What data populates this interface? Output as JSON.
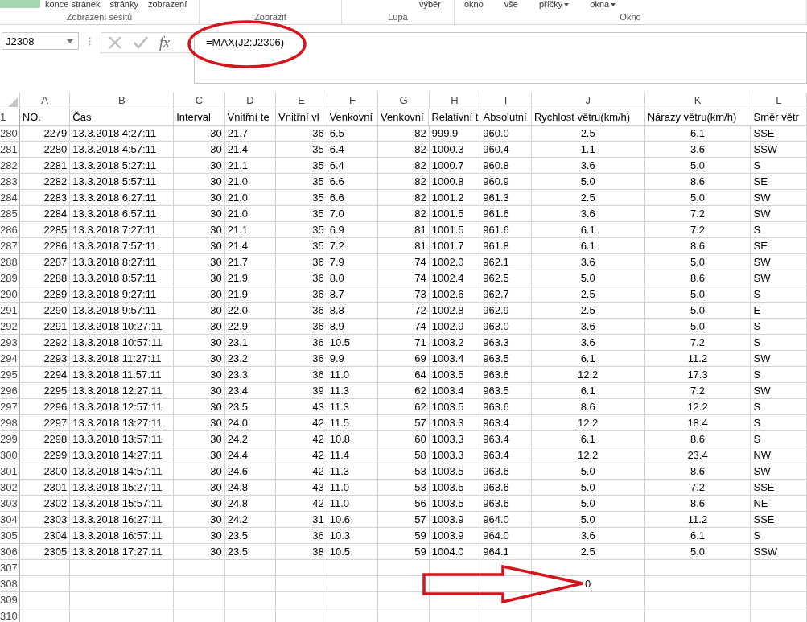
{
  "ribbon": {
    "groups": [
      {
        "label": "Zobrazení sešitů",
        "buttons": [
          {
            "label": "konce stránek",
            "dropdown": false
          },
          {
            "label": "stránky",
            "dropdown": false
          },
          {
            "label": "zobrazení",
            "dropdown": false
          }
        ]
      },
      {
        "label": "Zobrazit"
      },
      {
        "label": "Lupa",
        "buttons": [
          {
            "label": "výběr",
            "dropdown": false
          }
        ]
      },
      {
        "label": "Okno",
        "buttons": [
          {
            "label": "okno",
            "dropdown": false
          },
          {
            "label": "vše",
            "dropdown": false
          },
          {
            "label": "příčky",
            "dropdown": true
          },
          {
            "label": "okna",
            "dropdown": true
          }
        ]
      }
    ]
  },
  "name_box": {
    "value": "J2308"
  },
  "formula_bar": {
    "function_label": "fx",
    "value": "=MAX(J2:J2306)"
  },
  "sheet": {
    "column_letters": [
      "A",
      "B",
      "C",
      "D",
      "E",
      "F",
      "G",
      "H",
      "I",
      "J",
      "K",
      "L"
    ],
    "rows": [
      {
        "number": "1",
        "cells": [
          "NO.",
          "Čas",
          "Interval",
          "Vnitřní te",
          "Vnitřní vl",
          "Venkovní",
          "Venkovní",
          "Relativní t",
          "Absolutní",
          "Rychlost větru(km/h)",
          "Nárazy větru(km/h)",
          "Směr větr"
        ]
      },
      {
        "number": "280",
        "cells": [
          "2279",
          "13.3.2018 4:27:11",
          "30",
          "21.7",
          "36",
          "6.5",
          "82",
          "999.9",
          "960.0",
          "2.5",
          "6.1",
          "SSE"
        ]
      },
      {
        "number": "281",
        "cells": [
          "2280",
          "13.3.2018 4:57:11",
          "30",
          "21.4",
          "35",
          "6.4",
          "82",
          "1000.3",
          "960.4",
          "1.1",
          "3.6",
          "SSW"
        ]
      },
      {
        "number": "282",
        "cells": [
          "2281",
          "13.3.2018 5:27:11",
          "30",
          "21.1",
          "35",
          "6.4",
          "82",
          "1000.7",
          "960.8",
          "3.6",
          "5.0",
          "S"
        ]
      },
      {
        "number": "283",
        "cells": [
          "2282",
          "13.3.2018 5:57:11",
          "30",
          "21.0",
          "35",
          "6.6",
          "82",
          "1000.8",
          "960.9",
          "5.0",
          "8.6",
          "SE"
        ]
      },
      {
        "number": "284",
        "cells": [
          "2283",
          "13.3.2018 6:27:11",
          "30",
          "21.0",
          "35",
          "6.6",
          "82",
          "1001.2",
          "961.3",
          "2.5",
          "5.0",
          "SW"
        ]
      },
      {
        "number": "285",
        "cells": [
          "2284",
          "13.3.2018 6:57:11",
          "30",
          "21.0",
          "35",
          "7.0",
          "82",
          "1001.5",
          "961.6",
          "3.6",
          "7.2",
          "SW"
        ]
      },
      {
        "number": "286",
        "cells": [
          "2285",
          "13.3.2018 7:27:11",
          "30",
          "21.1",
          "35",
          "6.9",
          "81",
          "1001.5",
          "961.6",
          "6.1",
          "7.2",
          "S"
        ]
      },
      {
        "number": "287",
        "cells": [
          "2286",
          "13.3.2018 7:57:11",
          "30",
          "21.4",
          "35",
          "7.2",
          "81",
          "1001.7",
          "961.8",
          "6.1",
          "8.6",
          "SE"
        ]
      },
      {
        "number": "288",
        "cells": [
          "2287",
          "13.3.2018 8:27:11",
          "30",
          "21.7",
          "36",
          "7.9",
          "74",
          "1002.0",
          "962.1",
          "3.6",
          "5.0",
          "SW"
        ]
      },
      {
        "number": "289",
        "cells": [
          "2288",
          "13.3.2018 8:57:11",
          "30",
          "21.9",
          "36",
          "8.0",
          "74",
          "1002.4",
          "962.5",
          "5.0",
          "8.6",
          "SW"
        ]
      },
      {
        "number": "290",
        "cells": [
          "2289",
          "13.3.2018 9:27:11",
          "30",
          "21.9",
          "36",
          "8.7",
          "73",
          "1002.6",
          "962.7",
          "2.5",
          "5.0",
          "S"
        ]
      },
      {
        "number": "291",
        "cells": [
          "2290",
          "13.3.2018 9:57:11",
          "30",
          "22.0",
          "36",
          "8.8",
          "72",
          "1002.8",
          "962.9",
          "2.5",
          "5.0",
          "E"
        ]
      },
      {
        "number": "292",
        "cells": [
          "2291",
          "13.3.2018 10:27:11",
          "30",
          "22.9",
          "36",
          "8.9",
          "74",
          "1002.9",
          "963.0",
          "3.6",
          "5.0",
          "S"
        ]
      },
      {
        "number": "293",
        "cells": [
          "2292",
          "13.3.2018 10:57:11",
          "30",
          "23.1",
          "36",
          "10.5",
          "71",
          "1003.2",
          "963.3",
          "3.6",
          "7.2",
          "S"
        ]
      },
      {
        "number": "294",
        "cells": [
          "2293",
          "13.3.2018 11:27:11",
          "30",
          "23.2",
          "36",
          "9.9",
          "69",
          "1003.4",
          "963.5",
          "6.1",
          "11.2",
          "SW"
        ]
      },
      {
        "number": "295",
        "cells": [
          "2294",
          "13.3.2018 11:57:11",
          "30",
          "23.3",
          "36",
          "11.0",
          "64",
          "1003.5",
          "963.6",
          "12.2",
          "17.3",
          "S"
        ]
      },
      {
        "number": "296",
        "cells": [
          "2295",
          "13.3.2018 12:27:11",
          "30",
          "23.4",
          "39",
          "11.3",
          "62",
          "1003.4",
          "963.5",
          "6.1",
          "7.2",
          "SW"
        ]
      },
      {
        "number": "297",
        "cells": [
          "2296",
          "13.3.2018 12:57:11",
          "30",
          "23.5",
          "43",
          "11.3",
          "62",
          "1003.5",
          "963.6",
          "8.6",
          "12.2",
          "S"
        ]
      },
      {
        "number": "298",
        "cells": [
          "2297",
          "13.3.2018 13:27:11",
          "30",
          "24.0",
          "42",
          "11.5",
          "57",
          "1003.3",
          "963.4",
          "12.2",
          "18.4",
          "S"
        ]
      },
      {
        "number": "299",
        "cells": [
          "2298",
          "13.3.2018 13:57:11",
          "30",
          "24.2",
          "42",
          "10.8",
          "60",
          "1003.3",
          "963.4",
          "6.1",
          "8.6",
          "S"
        ]
      },
      {
        "number": "300",
        "cells": [
          "2299",
          "13.3.2018 14:27:11",
          "30",
          "24.4",
          "42",
          "11.4",
          "58",
          "1003.3",
          "963.4",
          "12.2",
          "23.4",
          "NW"
        ]
      },
      {
        "number": "301",
        "cells": [
          "2300",
          "13.3.2018 14:57:11",
          "30",
          "24.6",
          "42",
          "11.3",
          "53",
          "1003.5",
          "963.6",
          "5.0",
          "8.6",
          "SW"
        ]
      },
      {
        "number": "302",
        "cells": [
          "2301",
          "13.3.2018 15:27:11",
          "30",
          "24.8",
          "43",
          "11.0",
          "53",
          "1003.5",
          "963.6",
          "5.0",
          "7.2",
          "SSE"
        ]
      },
      {
        "number": "303",
        "cells": [
          "2302",
          "13.3.2018 15:57:11",
          "30",
          "24.8",
          "42",
          "11.0",
          "56",
          "1003.5",
          "963.6",
          "5.0",
          "8.6",
          "NE"
        ]
      },
      {
        "number": "304",
        "cells": [
          "2303",
          "13.3.2018 16:27:11",
          "30",
          "24.2",
          "31",
          "10.6",
          "57",
          "1003.9",
          "964.0",
          "5.0",
          "11.2",
          "SSE"
        ]
      },
      {
        "number": "305",
        "cells": [
          "2304",
          "13.3.2018 16:57:11",
          "30",
          "23.5",
          "36",
          "10.3",
          "59",
          "1003.9",
          "964.0",
          "3.6",
          "6.1",
          "S"
        ]
      },
      {
        "number": "306",
        "cells": [
          "2305",
          "13.3.2018 17:27:11",
          "30",
          "23.5",
          "38",
          "10.5",
          "59",
          "1004.0",
          "964.1",
          "2.5",
          "5.0",
          "SSW"
        ]
      },
      {
        "number": "307",
        "cells": [
          "",
          "",
          "",
          "",
          "",
          "",
          "",
          "",
          "",
          "",
          "",
          ""
        ]
      },
      {
        "number": "308",
        "cells": [
          "",
          "",
          "",
          "",
          "",
          "",
          "",
          "",
          "",
          "0",
          "",
          ""
        ]
      },
      {
        "number": "309",
        "cells": [
          "",
          "",
          "",
          "",
          "",
          "",
          "",
          "",
          "",
          "",
          "",
          ""
        ]
      },
      {
        "number": "310",
        "cells": [
          "",
          "",
          "",
          "",
          "",
          "",
          "",
          "",
          "",
          "",
          "",
          ""
        ]
      }
    ]
  }
}
